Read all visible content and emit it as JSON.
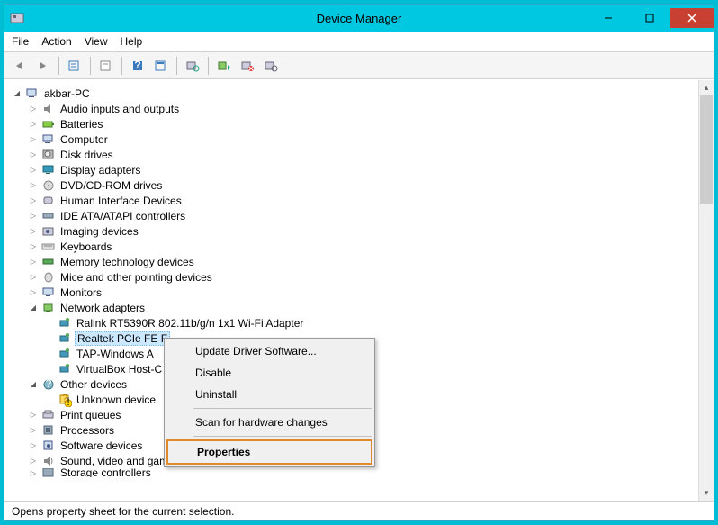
{
  "window": {
    "title": "Device Manager"
  },
  "menubar": [
    "File",
    "Action",
    "View",
    "Help"
  ],
  "toolbar_icons": [
    "back",
    "forward",
    "show-hidden",
    "properties-sheet",
    "help",
    "properties",
    "refresh",
    "update-driver",
    "disable-device",
    "scan-hardware"
  ],
  "tree": {
    "root": "akbar-PC",
    "categories": [
      {
        "label": "Audio inputs and outputs",
        "icon": "audio"
      },
      {
        "label": "Batteries",
        "icon": "battery"
      },
      {
        "label": "Computer",
        "icon": "computer"
      },
      {
        "label": "Disk drives",
        "icon": "disk"
      },
      {
        "label": "Display adapters",
        "icon": "display"
      },
      {
        "label": "DVD/CD-ROM drives",
        "icon": "optical"
      },
      {
        "label": "Human Interface Devices",
        "icon": "hid"
      },
      {
        "label": "IDE ATA/ATAPI controllers",
        "icon": "ide"
      },
      {
        "label": "Imaging devices",
        "icon": "imaging"
      },
      {
        "label": "Keyboards",
        "icon": "keyboard"
      },
      {
        "label": "Memory technology devices",
        "icon": "memory"
      },
      {
        "label": "Mice and other pointing devices",
        "icon": "mouse"
      },
      {
        "label": "Monitors",
        "icon": "monitor"
      },
      {
        "label": "Network adapters",
        "icon": "network",
        "expanded": true,
        "children": [
          {
            "label": "Ralink RT5390R 802.11b/g/n 1x1 Wi-Fi Adapter"
          },
          {
            "label": "Realtek PCIe FE F",
            "selected": true
          },
          {
            "label": "TAP-Windows A"
          },
          {
            "label": "VirtualBox Host-C"
          }
        ]
      },
      {
        "label": "Other devices",
        "icon": "other",
        "expanded": true,
        "children": [
          {
            "label": "Unknown device",
            "warn": true
          }
        ]
      },
      {
        "label": "Print queues",
        "icon": "print"
      },
      {
        "label": "Processors",
        "icon": "cpu"
      },
      {
        "label": "Software devices",
        "icon": "software"
      },
      {
        "label": "Sound, video and game controllers",
        "icon": "sound"
      },
      {
        "label": "Storage controllers",
        "icon": "storage",
        "cut": true
      }
    ]
  },
  "context_menu": {
    "items": [
      "Update Driver Software...",
      "Disable",
      "Uninstall",
      "---",
      "Scan for hardware changes",
      "---",
      "Properties"
    ],
    "highlighted": "Properties"
  },
  "statusbar": "Opens property sheet for the current selection."
}
